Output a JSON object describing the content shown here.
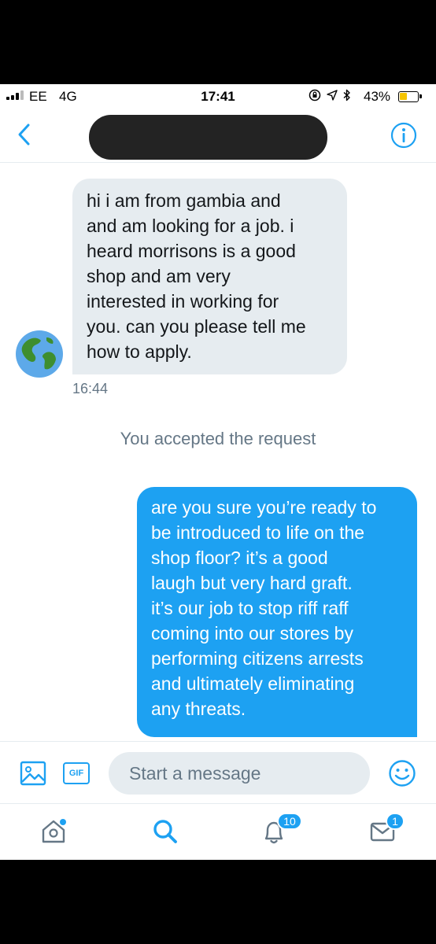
{
  "status_bar": {
    "carrier": "EE",
    "network": "4G",
    "time": "17:41",
    "battery_percent": "43%",
    "battery_level": 0.43,
    "battery_color": "#f5c400"
  },
  "header": {
    "back_icon": "chevron-left-icon",
    "title": "",
    "info_icon": "info-icon"
  },
  "conversation": {
    "incoming": {
      "avatar": "globe-earth-icon",
      "text": "hi i am from gambia and\nand am looking for a job. i\nheard morrisons is a good\nshop and am very\ninterested in working for\nyou. can you please tell me\nhow to apply.",
      "timestamp": "16:44"
    },
    "system_message": "You accepted the request",
    "outgoing": {
      "text": "are you sure you’re ready to\nbe introduced to life on the\nshop floor? it’s a good\nlaugh but very hard graft.\nit’s our job to stop riff raff\ncoming into our stores by\nperforming citizens arrests\nand ultimately eliminating\nany threats."
    }
  },
  "composer": {
    "media_icon": "image-icon",
    "gif_label": "GIF",
    "placeholder": "Start a message",
    "emoji_icon": "smiley-icon"
  },
  "tab_bar": {
    "home_icon": "home-icon",
    "search_icon": "search-icon",
    "notifications_icon": "bell-icon",
    "notifications_count": "10",
    "messages_icon": "envelope-icon",
    "messages_count": "1"
  },
  "colors": {
    "accent": "#1da1f2",
    "incoming_bubble": "#e6ecf0",
    "muted_text": "#657786"
  }
}
